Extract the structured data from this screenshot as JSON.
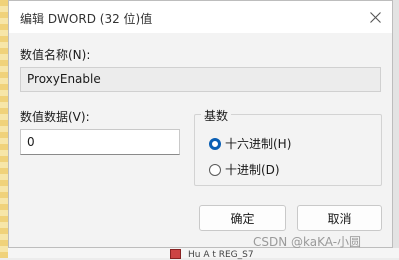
{
  "dialog": {
    "title": "编辑 DWORD (32 位)值",
    "value_name_label": "数值名称(N):",
    "value_name": "ProxyEnable",
    "value_data_label": "数值数据(V):",
    "value_data": "0",
    "base_label": "基数",
    "base_options": [
      {
        "label": "十六进制(H)",
        "selected": true
      },
      {
        "label": "十进制(D)",
        "selected": false
      }
    ],
    "ok_label": "确定",
    "cancel_label": "取消"
  },
  "background": {
    "partial_text": "Hu  A   t        REG_S7"
  },
  "watermark": "CSDN @kaKA-小圆"
}
